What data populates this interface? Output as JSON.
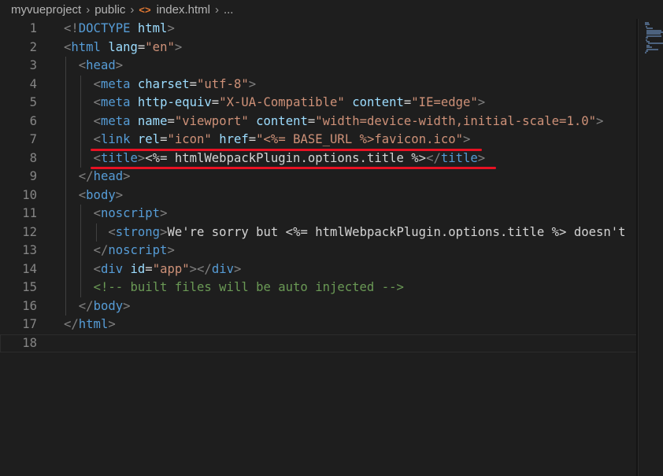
{
  "breadcrumb": {
    "items": [
      "myvueproject",
      "public",
      "index.html",
      "..."
    ],
    "file_icon": "<>"
  },
  "editor": {
    "line_numbers": [
      "1",
      "2",
      "3",
      "4",
      "5",
      "6",
      "7",
      "8",
      "9",
      "10",
      "11",
      "12",
      "13",
      "14",
      "15",
      "16",
      "17",
      "18"
    ],
    "lines": [
      [
        {
          "c": "bracket",
          "t": "<!"
        },
        {
          "c": "tag",
          "t": "DOCTYPE"
        },
        {
          "c": "text",
          "t": " "
        },
        {
          "c": "attr",
          "t": "html"
        },
        {
          "c": "bracket",
          "t": ">"
        }
      ],
      [
        {
          "c": "bracket",
          "t": "<"
        },
        {
          "c": "tag",
          "t": "html"
        },
        {
          "c": "text",
          "t": " "
        },
        {
          "c": "attr",
          "t": "lang"
        },
        {
          "c": "text",
          "t": "="
        },
        {
          "c": "str",
          "t": "\"en\""
        },
        {
          "c": "bracket",
          "t": ">"
        }
      ],
      [
        {
          "c": "text",
          "t": "  "
        },
        {
          "c": "bracket",
          "t": "<"
        },
        {
          "c": "tag",
          "t": "head"
        },
        {
          "c": "bracket",
          "t": ">"
        }
      ],
      [
        {
          "c": "text",
          "t": "    "
        },
        {
          "c": "bracket",
          "t": "<"
        },
        {
          "c": "tag",
          "t": "meta"
        },
        {
          "c": "text",
          "t": " "
        },
        {
          "c": "attr",
          "t": "charset"
        },
        {
          "c": "text",
          "t": "="
        },
        {
          "c": "str",
          "t": "\"utf-8\""
        },
        {
          "c": "bracket",
          "t": ">"
        }
      ],
      [
        {
          "c": "text",
          "t": "    "
        },
        {
          "c": "bracket",
          "t": "<"
        },
        {
          "c": "tag",
          "t": "meta"
        },
        {
          "c": "text",
          "t": " "
        },
        {
          "c": "attr",
          "t": "http-equiv"
        },
        {
          "c": "text",
          "t": "="
        },
        {
          "c": "str",
          "t": "\"X-UA-Compatible\""
        },
        {
          "c": "text",
          "t": " "
        },
        {
          "c": "attr",
          "t": "content"
        },
        {
          "c": "text",
          "t": "="
        },
        {
          "c": "str",
          "t": "\"IE=edge\""
        },
        {
          "c": "bracket",
          "t": ">"
        }
      ],
      [
        {
          "c": "text",
          "t": "    "
        },
        {
          "c": "bracket",
          "t": "<"
        },
        {
          "c": "tag",
          "t": "meta"
        },
        {
          "c": "text",
          "t": " "
        },
        {
          "c": "attr",
          "t": "name"
        },
        {
          "c": "text",
          "t": "="
        },
        {
          "c": "str",
          "t": "\"viewport\""
        },
        {
          "c": "text",
          "t": " "
        },
        {
          "c": "attr",
          "t": "content"
        },
        {
          "c": "text",
          "t": "="
        },
        {
          "c": "str",
          "t": "\"width=device-width,initial-scale=1.0\""
        },
        {
          "c": "bracket",
          "t": ">"
        }
      ],
      [
        {
          "c": "text",
          "t": "    "
        },
        {
          "c": "bracket",
          "t": "<"
        },
        {
          "c": "tag",
          "t": "link"
        },
        {
          "c": "text",
          "t": " "
        },
        {
          "c": "attr",
          "t": "rel"
        },
        {
          "c": "text",
          "t": "="
        },
        {
          "c": "str",
          "t": "\"icon\""
        },
        {
          "c": "text",
          "t": " "
        },
        {
          "c": "attr",
          "t": "href"
        },
        {
          "c": "text",
          "t": "="
        },
        {
          "c": "str",
          "t": "\"<%= BASE_URL %>favicon.ico\""
        },
        {
          "c": "bracket",
          "t": ">"
        }
      ],
      [
        {
          "c": "text",
          "t": "    "
        },
        {
          "c": "bracket",
          "t": "<"
        },
        {
          "c": "tag",
          "t": "title"
        },
        {
          "c": "bracket",
          "t": ">"
        },
        {
          "c": "text",
          "t": "<%= htmlWebpackPlugin.options.title %>"
        },
        {
          "c": "bracket",
          "t": "</"
        },
        {
          "c": "tag",
          "t": "title"
        },
        {
          "c": "bracket",
          "t": ">"
        }
      ],
      [
        {
          "c": "text",
          "t": "  "
        },
        {
          "c": "bracket",
          "t": "</"
        },
        {
          "c": "tag",
          "t": "head"
        },
        {
          "c": "bracket",
          "t": ">"
        }
      ],
      [
        {
          "c": "text",
          "t": "  "
        },
        {
          "c": "bracket",
          "t": "<"
        },
        {
          "c": "tag",
          "t": "body"
        },
        {
          "c": "bracket",
          "t": ">"
        }
      ],
      [
        {
          "c": "text",
          "t": "    "
        },
        {
          "c": "bracket",
          "t": "<"
        },
        {
          "c": "tag",
          "t": "noscript"
        },
        {
          "c": "bracket",
          "t": ">"
        }
      ],
      [
        {
          "c": "text",
          "t": "      "
        },
        {
          "c": "bracket",
          "t": "<"
        },
        {
          "c": "tag",
          "t": "strong"
        },
        {
          "c": "bracket",
          "t": ">"
        },
        {
          "c": "text",
          "t": "We're sorry but <%= htmlWebpackPlugin.options.title %> doesn't"
        }
      ],
      [
        {
          "c": "text",
          "t": "    "
        },
        {
          "c": "bracket",
          "t": "</"
        },
        {
          "c": "tag",
          "t": "noscript"
        },
        {
          "c": "bracket",
          "t": ">"
        }
      ],
      [
        {
          "c": "text",
          "t": "    "
        },
        {
          "c": "bracket",
          "t": "<"
        },
        {
          "c": "tag",
          "t": "div"
        },
        {
          "c": "text",
          "t": " "
        },
        {
          "c": "attr",
          "t": "id"
        },
        {
          "c": "text",
          "t": "="
        },
        {
          "c": "str",
          "t": "\"app\""
        },
        {
          "c": "bracket",
          "t": "></"
        },
        {
          "c": "tag",
          "t": "div"
        },
        {
          "c": "bracket",
          "t": ">"
        }
      ],
      [
        {
          "c": "text",
          "t": "    "
        },
        {
          "c": "comment",
          "t": "<!-- built files will be auto injected -->"
        }
      ],
      [
        {
          "c": "text",
          "t": "  "
        },
        {
          "c": "bracket",
          "t": "</"
        },
        {
          "c": "tag",
          "t": "body"
        },
        {
          "c": "bracket",
          "t": ">"
        }
      ],
      [
        {
          "c": "bracket",
          "t": "</"
        },
        {
          "c": "tag",
          "t": "html"
        },
        {
          "c": "bracket",
          "t": ">"
        }
      ],
      []
    ],
    "current_line": 18,
    "highlighted_lines": [
      7,
      8
    ],
    "highlight_color": "#e81123"
  }
}
